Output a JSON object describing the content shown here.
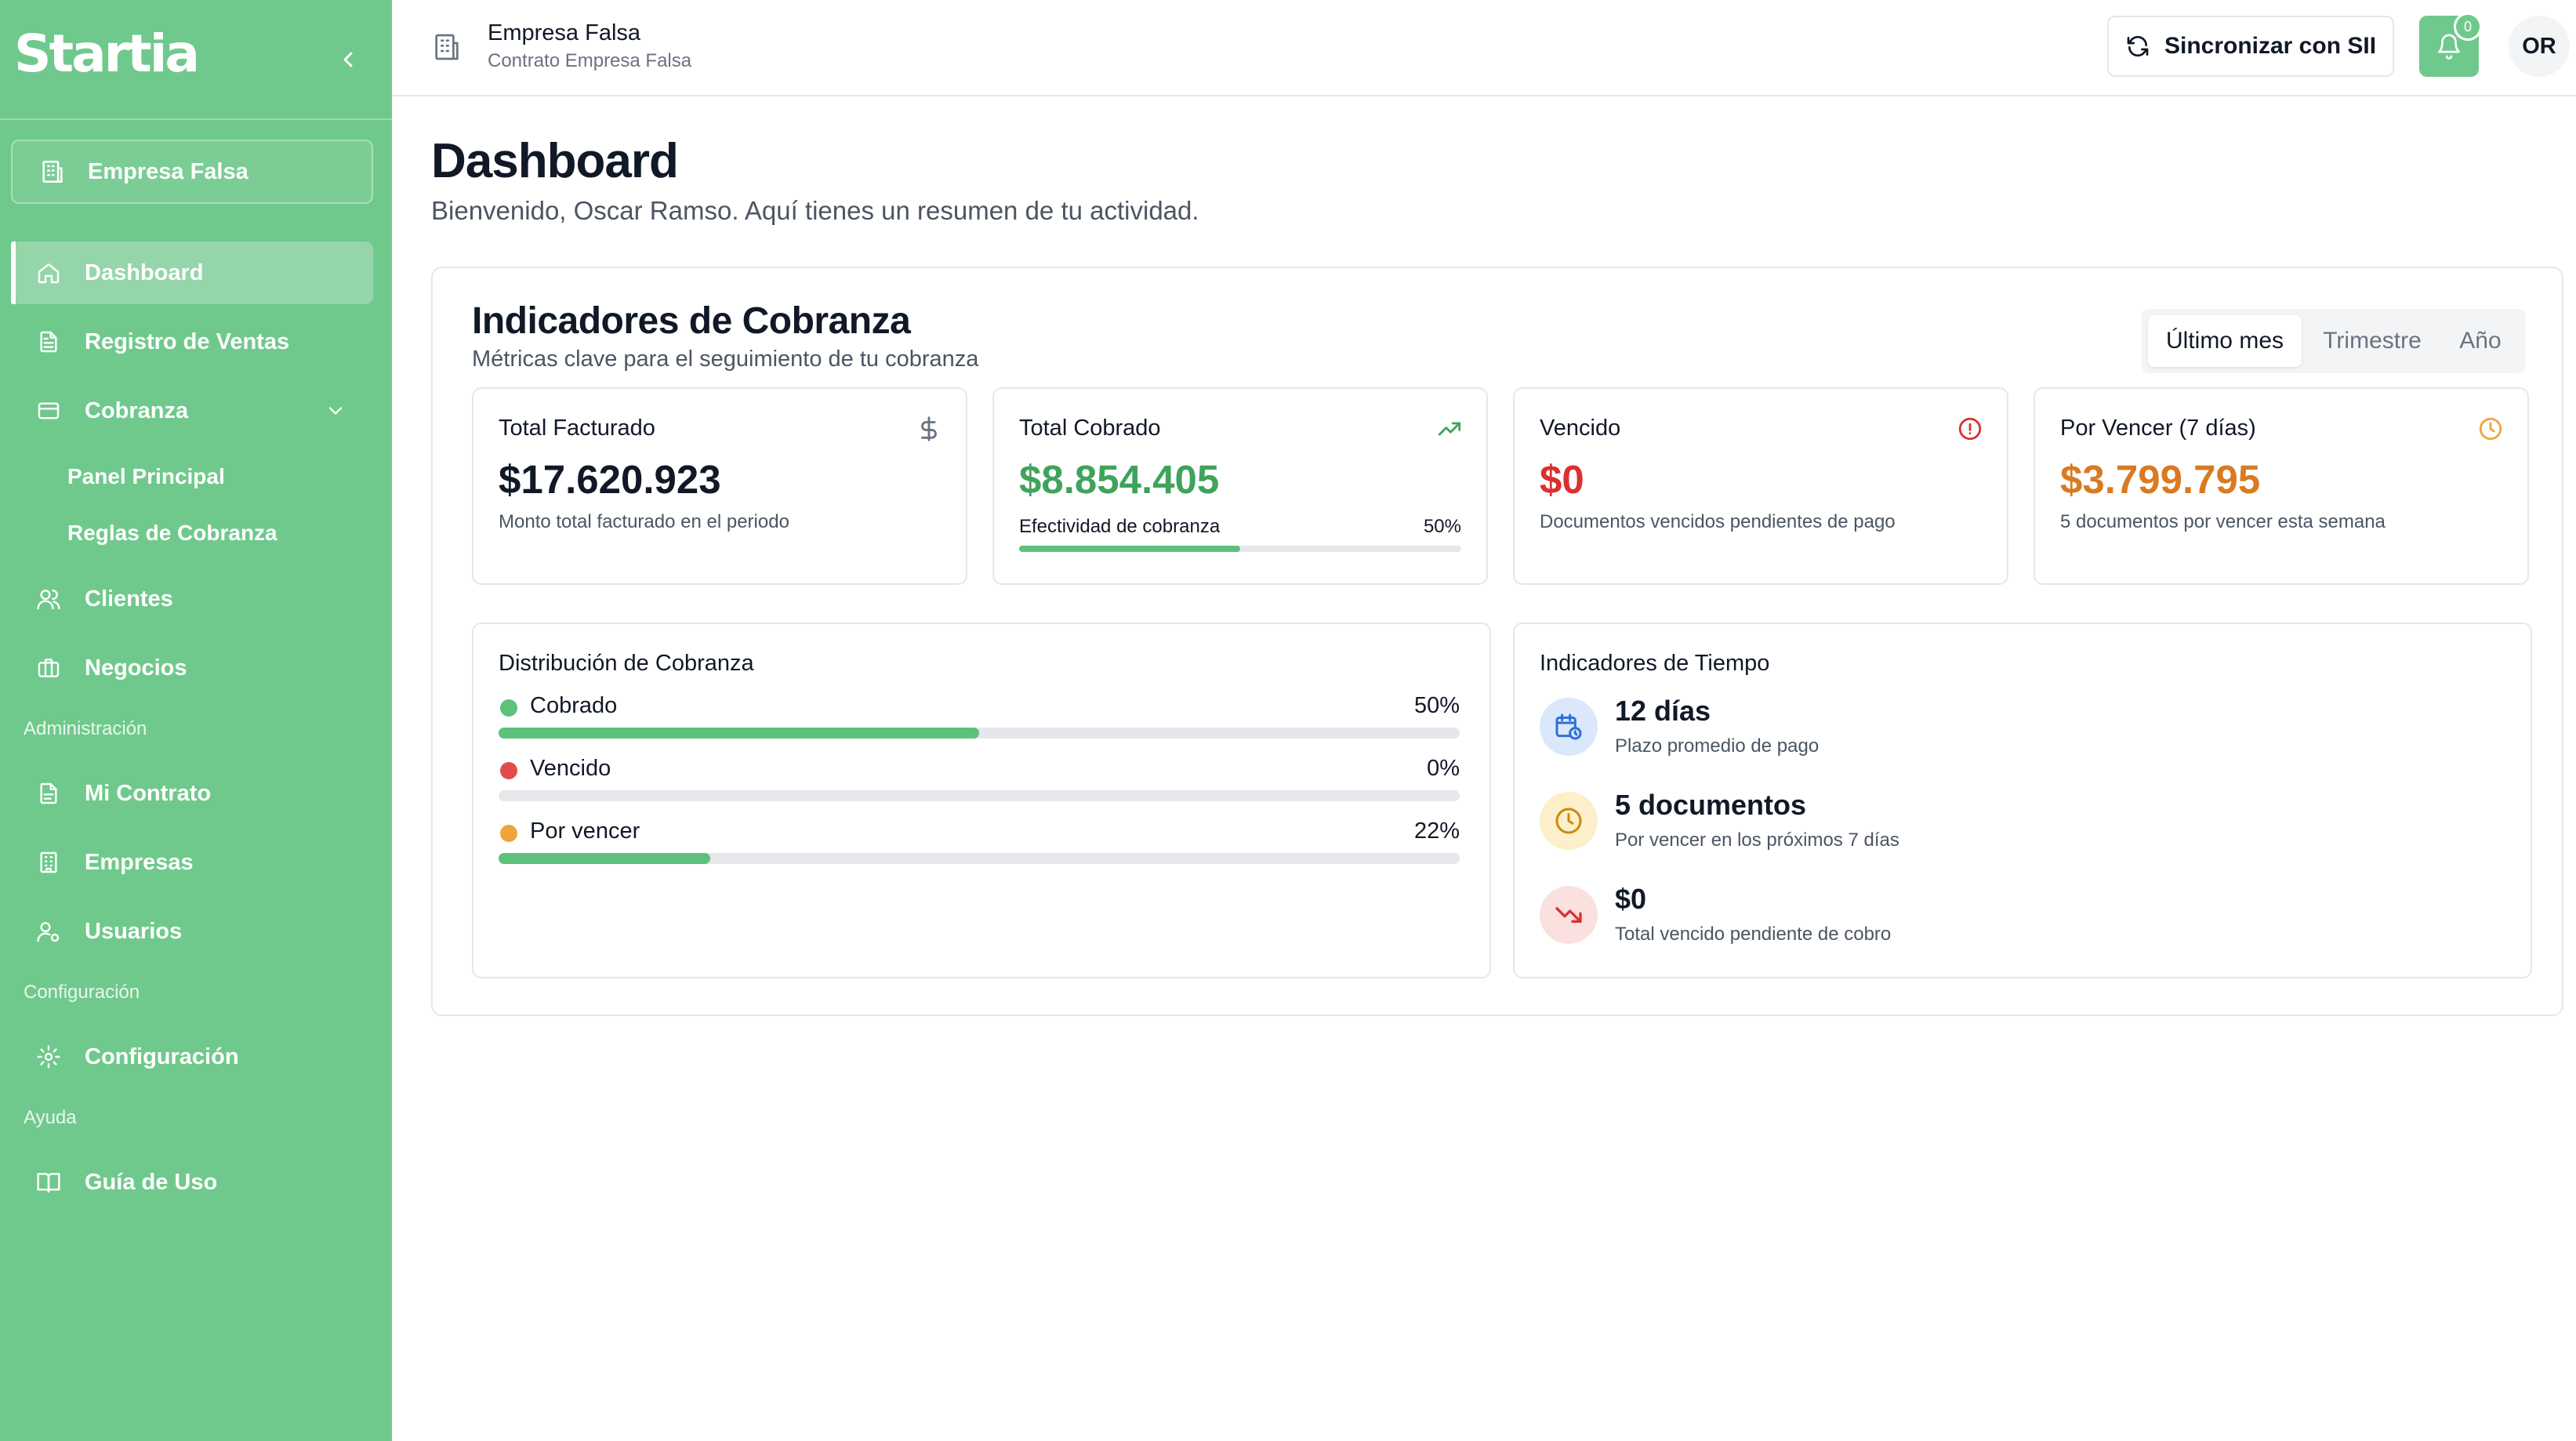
{
  "sidebar": {
    "logo": "Startia",
    "company": "Empresa Falsa",
    "nav": {
      "dashboard": "Dashboard",
      "registro_ventas": "Registro de Ventas",
      "cobranza": "Cobranza",
      "panel_principal": "Panel Principal",
      "reglas_cobranza": "Reglas de Cobranza",
      "clientes": "Clientes",
      "negocios": "Negocios"
    },
    "sections": {
      "administracion": "Administración",
      "configuracion": "Configuración",
      "ayuda": "Ayuda"
    },
    "admin": {
      "mi_contrato": "Mi Contrato",
      "empresas": "Empresas",
      "usuarios": "Usuarios"
    },
    "config": {
      "configuracion": "Configuración"
    },
    "help": {
      "guia": "Guía de Uso"
    }
  },
  "topbar": {
    "company_name": "Empresa Falsa",
    "contract": "Contrato Empresa Falsa",
    "sync_label": "Sincronizar con SII",
    "notifications_count": "0",
    "avatar_initials": "OR"
  },
  "page": {
    "title": "Dashboard",
    "subtitle": "Bienvenido, Oscar Ramso. Aquí tienes un resumen de tu actividad."
  },
  "indicators": {
    "title": "Indicadores de Cobranza",
    "subtitle": "Métricas clave para el seguimiento de tu cobranza",
    "period_tabs": [
      "Último mes",
      "Trimestre",
      "Año"
    ],
    "active_period": "Último mes",
    "kpis": {
      "facturado": {
        "label": "Total Facturado",
        "value": "$17.620.923",
        "desc": "Monto total facturado en el periodo",
        "icon": "dollar-icon"
      },
      "cobrado": {
        "label": "Total Cobrado",
        "value": "$8.854.405",
        "effectiveness_label": "Efectividad de cobranza",
        "effectiveness_pct": "50%",
        "effectiveness_fraction": 0.5,
        "icon": "trending-up-icon"
      },
      "vencido": {
        "label": "Vencido",
        "value": "$0",
        "desc": "Documentos vencidos pendientes de pago",
        "icon": "alert-circle-icon"
      },
      "por_vencer": {
        "label": "Por Vencer (7 días)",
        "value": "$3.799.795",
        "desc": "5 documentos por vencer esta semana",
        "icon": "clock-icon"
      }
    },
    "distribution": {
      "title": "Distribución de Cobranza",
      "rows": [
        {
          "name": "Cobrado",
          "pct": "50%",
          "fraction": 0.5,
          "dot_color": "#5cc17a"
        },
        {
          "name": "Vencido",
          "pct": "0%",
          "fraction": 0,
          "dot_color": "#e14b4b"
        },
        {
          "name": "Por vencer",
          "pct": "22%",
          "fraction": 0.22,
          "dot_color": "#f0a53a"
        }
      ]
    },
    "time": {
      "title": "Indicadores de Tiempo",
      "rows": [
        {
          "value": "12 días",
          "desc": "Plazo promedio de pago",
          "icon": "calendar-clock-icon"
        },
        {
          "value": "5 documentos",
          "desc": "Por vencer en los próximos 7 días",
          "icon": "clock-icon"
        },
        {
          "value": "$0",
          "desc": "Total vencido pendiente de cobro",
          "icon": "trending-down-icon"
        }
      ]
    }
  },
  "colors": {
    "brand_green": "#70c98c",
    "positive": "#3fa35b",
    "danger": "#dc3030",
    "warning": "#d97a22"
  }
}
